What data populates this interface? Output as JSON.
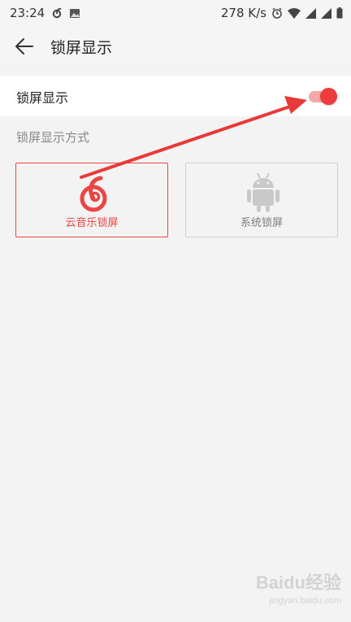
{
  "status_bar": {
    "time": "23:24",
    "network_speed": "278 K/s",
    "icons": [
      "netease-music-icon",
      "image-icon",
      "alarm-icon",
      "wifi-icon",
      "signal-icon",
      "signal-icon",
      "battery-icon"
    ]
  },
  "header": {
    "title": "锁屏显示",
    "back_icon": "back-arrow-icon"
  },
  "settings": {
    "lockscreen_toggle": {
      "label": "锁屏显示",
      "enabled": true
    },
    "mode_section_label": "锁屏显示方式",
    "modes": [
      {
        "label": "云音乐锁屏",
        "icon": "netease-music-logo-icon",
        "selected": true
      },
      {
        "label": "系统锁屏",
        "icon": "android-robot-icon",
        "selected": false
      }
    ]
  },
  "colors": {
    "accent": "#e94545",
    "toggle_thumb": "#ef3b3b",
    "toggle_track": "#f4a8a8",
    "background": "#f3f3f3",
    "disabled_gray": "#c9c9c9"
  },
  "watermark": {
    "text": "Baidu经验",
    "sub": "jingyan.baidu.com"
  }
}
